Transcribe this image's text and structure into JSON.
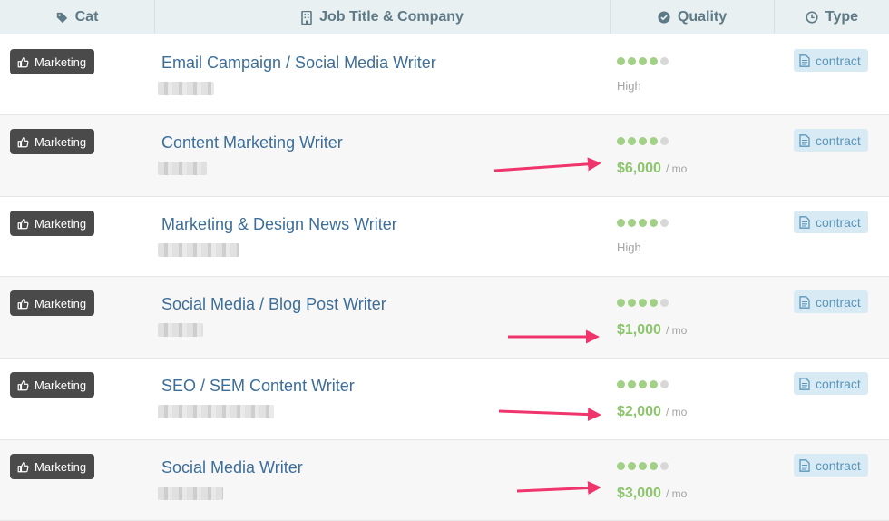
{
  "header": {
    "cat_label": "Cat",
    "job_label": "Job Title & Company",
    "quality_label": "Quality",
    "type_label": "Type",
    "cat_icon": "tag-icon",
    "job_icon": "building-icon",
    "quality_icon": "check-circle-icon",
    "type_icon": "clock-icon"
  },
  "colors": {
    "header_bg": "#e9f0f2",
    "header_text": "#5e7a86",
    "job_title": "#3d6e99",
    "rating_on": "#a2d086",
    "rating_off": "#d8d8d8",
    "salary": "#8cc56c",
    "category_badge": "#4a4a4a",
    "type_badge_bg": "#d8ebf5",
    "type_badge_text": "#5b95b8",
    "arrow": "#f0346c"
  },
  "rows": [
    {
      "category": "Marketing",
      "title": "Email Campaign / Social Media Writer",
      "rating": 4,
      "rating_max": 5,
      "quality_text": "High",
      "salary": "",
      "salary_unit": "",
      "type": "contract"
    },
    {
      "category": "Marketing",
      "title": "Content Marketing Writer",
      "rating": 4,
      "rating_max": 5,
      "quality_text": "",
      "salary": "$6,000",
      "salary_unit": "/ mo",
      "type": "contract"
    },
    {
      "category": "Marketing",
      "title": "Marketing & Design News Writer",
      "rating": 4,
      "rating_max": 5,
      "quality_text": "High",
      "salary": "",
      "salary_unit": "",
      "type": "contract"
    },
    {
      "category": "Marketing",
      "title": "Social Media / Blog Post Writer",
      "rating": 4,
      "rating_max": 5,
      "quality_text": "",
      "salary": "$1,000",
      "salary_unit": "/ mo",
      "type": "contract"
    },
    {
      "category": "Marketing",
      "title": "SEO / SEM Content Writer",
      "rating": 4,
      "rating_max": 5,
      "quality_text": "",
      "salary": "$2,000",
      "salary_unit": "/ mo",
      "type": "contract"
    },
    {
      "category": "Marketing",
      "title": "Social Media Writer",
      "rating": 4,
      "rating_max": 5,
      "quality_text": "",
      "salary": "$3,000",
      "salary_unit": "/ mo",
      "type": "contract"
    }
  ]
}
